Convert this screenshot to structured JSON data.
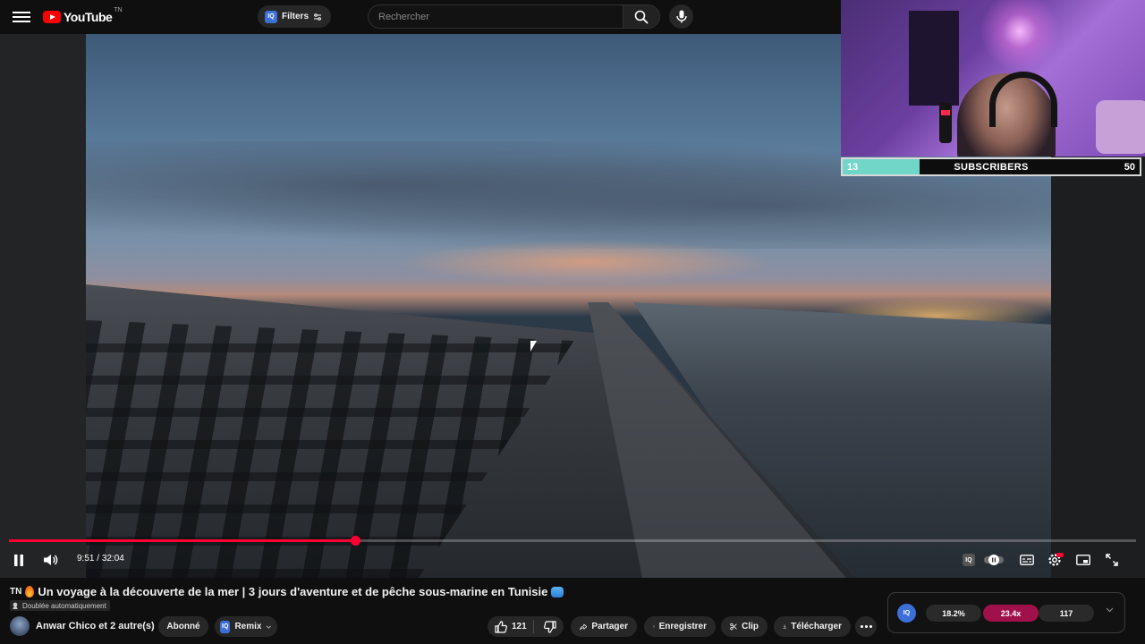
{
  "header": {
    "logo_text": "YouTube",
    "country_code": "TN",
    "filters_badge": "IQ",
    "filters_label": "Filters",
    "search_placeholder": "Rechercher"
  },
  "player": {
    "current_time": "9:51",
    "time_separator": " / ",
    "duration": "32:04",
    "progress_fraction": 0.3072,
    "state": "playing",
    "controls_badge": "IQ"
  },
  "overlay": {
    "subscriber_current": "13",
    "subscriber_label": "SUBSCRIBERS",
    "subscriber_goal": "50",
    "subscriber_fraction": 0.26,
    "fill_color": "#6fd6c8"
  },
  "video": {
    "country_tag": "TN",
    "title": "Un voyage à la découverte de la mer | 3 jours d'aventure et de pêche sous-marine en Tunisie",
    "dubbed_label": "Doublée automatiquement"
  },
  "channel": {
    "name": "Anwar Chico et 2 autre(s)",
    "subscribe_label": "Abonné",
    "remix_badge": "IQ",
    "remix_label": "Remix"
  },
  "actions": {
    "like_count": "121",
    "share_label": "Partager",
    "save_label": "Enregistrer",
    "clip_label": "Clip",
    "download_label": "Télécharger"
  },
  "iq_panel": {
    "badge": "IQ",
    "stat1": "18.2%",
    "stat2": "23.4x",
    "stat2_color": "#a0114c",
    "stat3": "117"
  },
  "colors": {
    "accent_red": "#ff0033",
    "iq_blue": "#3d6fd8",
    "background": "#0f0f0f"
  }
}
